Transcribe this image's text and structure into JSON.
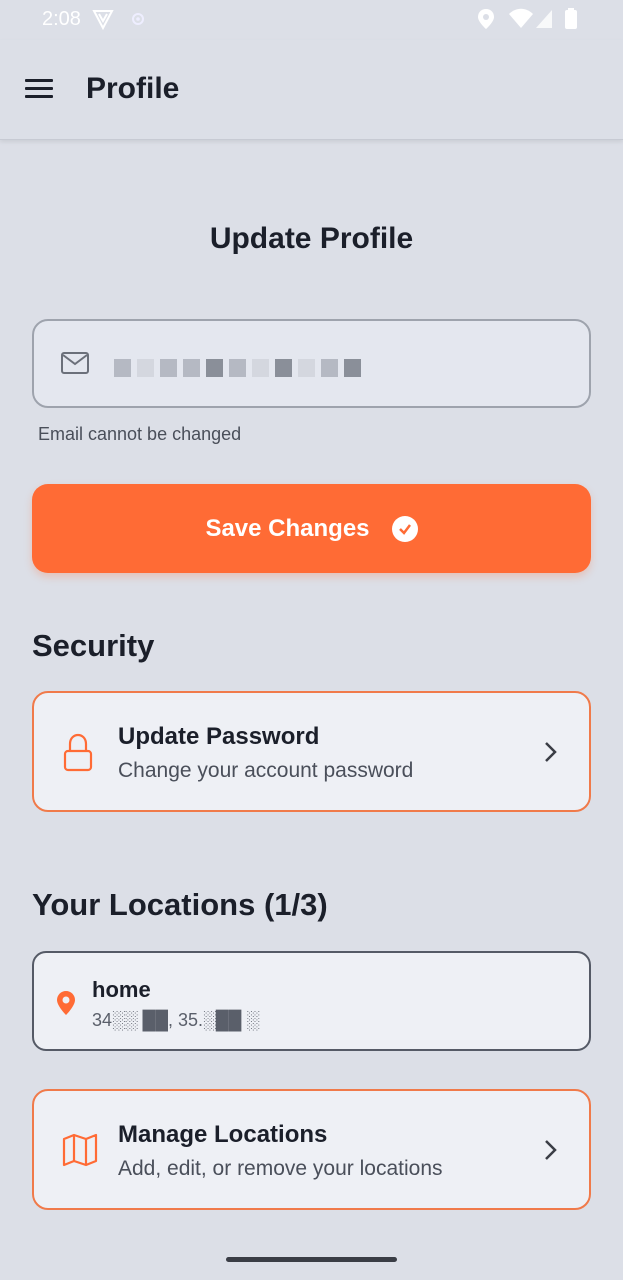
{
  "status_bar": {
    "time": "2:08",
    "icons": [
      "vpn-shield-icon",
      "location-sync-icon",
      "location-icon",
      "wifi-icon",
      "signal-icon",
      "battery-icon"
    ]
  },
  "app_bar": {
    "title": "Profile",
    "menu_icon": "hamburger-menu-icon"
  },
  "update_profile": {
    "title": "Update Profile",
    "email_field": {
      "icon": "mail-icon",
      "value_masked": true,
      "helper_text": "Email cannot be changed"
    },
    "save_button": {
      "label": "Save Changes",
      "icon": "check-circle-icon"
    }
  },
  "security": {
    "heading": "Security",
    "update_password": {
      "title": "Update Password",
      "subtitle": "Change your account password",
      "icon": "lock-icon"
    }
  },
  "locations": {
    "heading": "Your Locations (1/3)",
    "items": [
      {
        "name": "home",
        "coords_display": "34░░ ██, 35.░██ ░"
      }
    ],
    "manage": {
      "title": "Manage Locations",
      "subtitle": "Add, edit, or remove your locations",
      "icon": "map-icon"
    }
  },
  "colors": {
    "accent": "#ff6b35",
    "background": "#dcdfe7",
    "card_border": "#f07a4a",
    "text": "#1b1f2a"
  }
}
